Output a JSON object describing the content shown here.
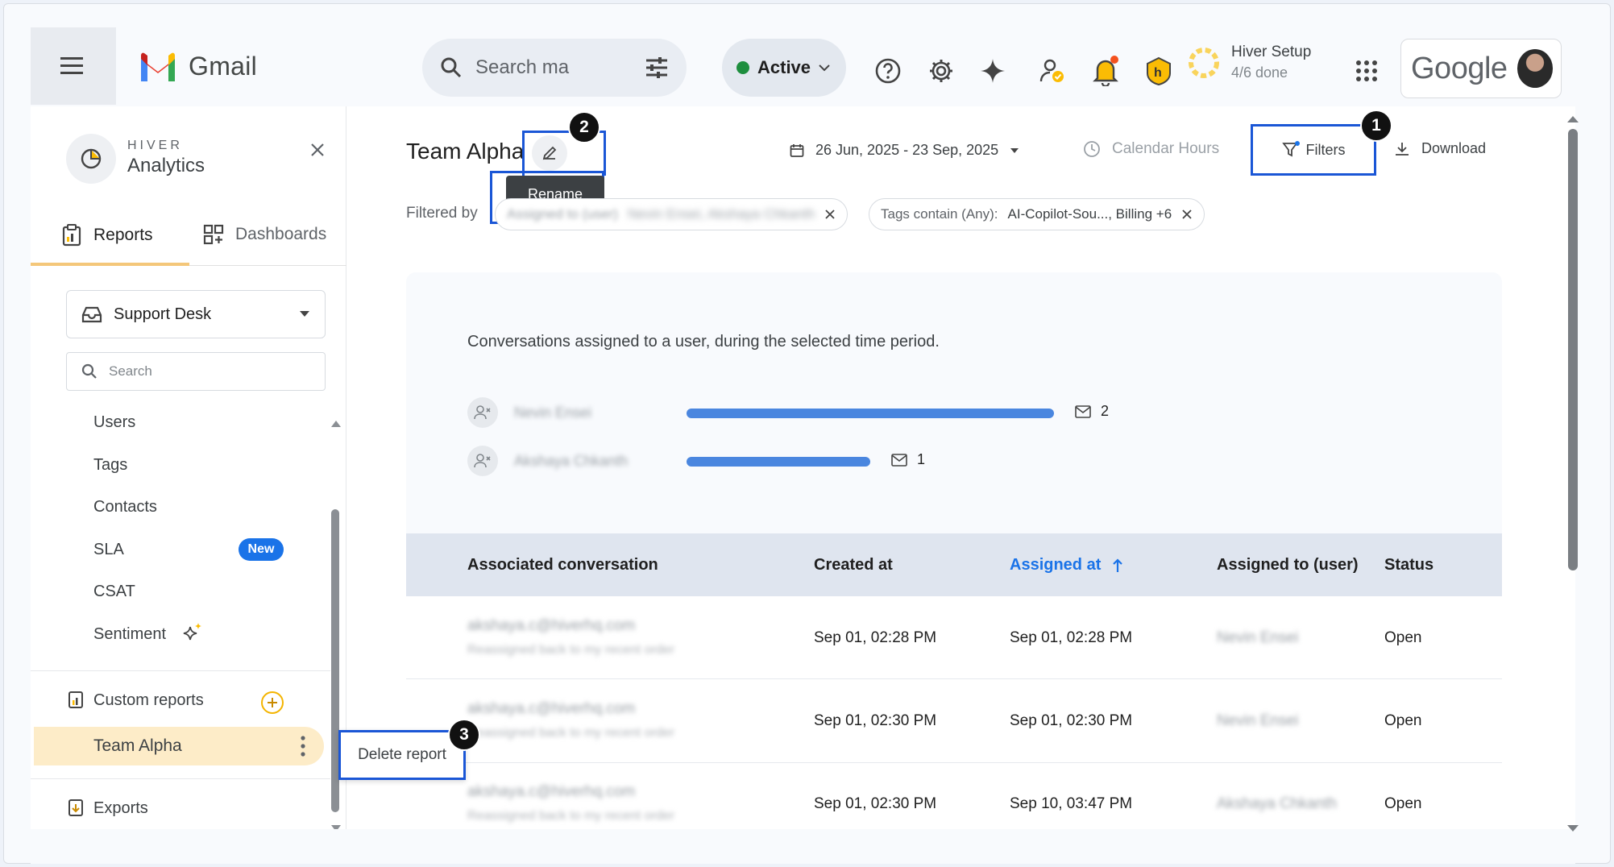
{
  "topbar": {
    "app_name": "Gmail",
    "search_placeholder": "Search ma",
    "status_label": "Active",
    "setup_title": "Hiver Setup",
    "setup_progress": "4/6 done",
    "account_brand": "Google"
  },
  "sidebar": {
    "brand_top": "HIVER",
    "brand_main": "Analytics",
    "tabs": [
      {
        "label": "Reports"
      },
      {
        "label": "Dashboards"
      }
    ],
    "inbox_select": "Support Desk",
    "search_placeholder": "Search",
    "items": [
      {
        "label": "Users"
      },
      {
        "label": "Tags"
      },
      {
        "label": "Contacts"
      },
      {
        "label": "SLA"
      },
      {
        "label": "CSAT"
      },
      {
        "label": "Sentiment"
      }
    ],
    "new_badge": "New",
    "custom_reports_label": "Custom reports",
    "active_report": "Team Alpha",
    "exports_label": "Exports",
    "context_menu": {
      "delete_label": "Delete report"
    }
  },
  "callouts": [
    "1",
    "2",
    "3"
  ],
  "content": {
    "report_title": "Team Alpha",
    "rename_tooltip": "Rename",
    "date_range": "26 Jun, 2025 - 23 Sep, 2025",
    "calendar_hours": "Calendar Hours",
    "filters_label": "Filters",
    "download_label": "Download",
    "filtered_by_label": "Filtered by",
    "chips": [
      {
        "label": "Assigned to (user)",
        "value": "Nevin Ensei, Akshaya Chkanth"
      },
      {
        "label": "Tags contain (Any):",
        "value": "AI-Copilot-Sou..., Billing +6"
      }
    ],
    "description": "Conversations assigned to a user, during the selected time period.",
    "bars": [
      {
        "user": "Nevin Ensei",
        "count": "2",
        "value": 2
      },
      {
        "user": "Akshaya Chkanth",
        "count": "1",
        "value": 1
      }
    ],
    "table": {
      "headers": [
        "Associated conversation",
        "Created at",
        "Assigned at",
        "Assigned to (user)",
        "Status"
      ],
      "rows": [
        {
          "email": "akshaya.c@hiverhq.com",
          "subject": "Reassigned back to my recent order",
          "created": "Sep 01, 02:28 PM",
          "assigned": "Sep 01, 02:28 PM",
          "user": "Nevin Ensei",
          "status": "Open"
        },
        {
          "email": "akshaya.c@hiverhq.com",
          "subject": "Reassigned back to my recent order",
          "created": "Sep 01, 02:30 PM",
          "assigned": "Sep 01, 02:30 PM",
          "user": "Nevin Ensei",
          "status": "Open"
        },
        {
          "email": "akshaya.c@hiverhq.com",
          "subject": "Reassigned back to my recent order",
          "created": "Sep 01, 02:30 PM",
          "assigned": "Sep 10, 03:47 PM",
          "user": "Akshaya Chkanth",
          "status": "Open"
        }
      ]
    }
  },
  "colors": {
    "accent": "#1a73e8",
    "callout_outline": "#1a56d6",
    "active_row": "#fdecc8",
    "bar": "#4a86df"
  }
}
